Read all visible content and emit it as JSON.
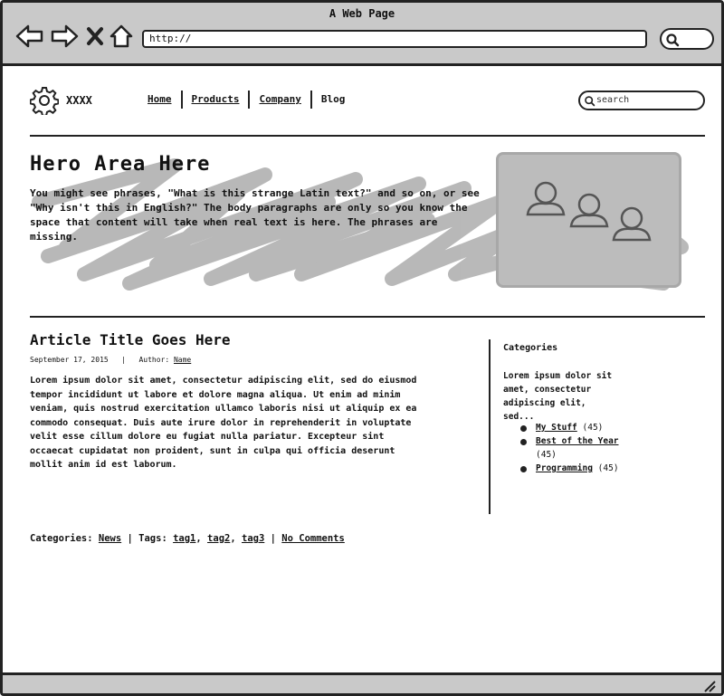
{
  "window": {
    "title": "A Web Page"
  },
  "browser": {
    "url": "http://"
  },
  "site": {
    "name": "XXXX",
    "nav": [
      "Home",
      "Products",
      "Company",
      "Blog"
    ],
    "search_placeholder": "search"
  },
  "hero": {
    "title": "Hero Area Here",
    "text": "You might see phrases, \"What is this strange Latin text?\" and so on, or see \"Why isn't this in English?\" The body paragraphs are only so you know the space that content will take when real text is here. The phrases are missing."
  },
  "post": {
    "title": "Article Title Goes Here",
    "date": "September 17, 2015",
    "meta_separator": "|",
    "author_label": "Author:",
    "author": "Name",
    "body": "Lorem ipsum dolor sit amet, consectetur adipiscing elit, sed do eiusmod tempor incididunt ut labore et dolore magna aliqua. Ut enim ad minim veniam, quis nostrud exercitation ullamco laboris nisi ut aliquip ex ea commodo consequat. Duis aute irure dolor in reprehenderit in voluptate velit esse cillum dolore eu fugiat nulla pariatur. Excepteur sint occaecat cupidatat non proident, sunt in culpa qui officia deserunt mollit anim id est laborum."
  },
  "sidebar": {
    "heading": "Categories",
    "text": "Lorem ipsum dolor sit amet, consectetur adipiscing elit, sed...",
    "items": [
      {
        "link": "My Stuff",
        "count": "(45)"
      },
      {
        "link": "Best of the Year",
        "count": "(45)"
      },
      {
        "link": "Programming",
        "count": "(45)"
      }
    ]
  },
  "footer": {
    "categories_label": "Categories:",
    "category": "News",
    "separator": "|",
    "tags_label": "Tags:",
    "tags": [
      "tag1",
      "tag2",
      "tag3"
    ],
    "comments": "No Comments"
  },
  "colors": {
    "chrome": "#c9c9c9",
    "hero_image": "#bcbcbc",
    "scribble": "#b5b5b5"
  },
  "icons": [
    "back-arrow-icon",
    "forward-arrow-icon",
    "close-icon",
    "home-icon",
    "search-icon",
    "gear-icon",
    "users-icon",
    "resize-grip-icon"
  ]
}
